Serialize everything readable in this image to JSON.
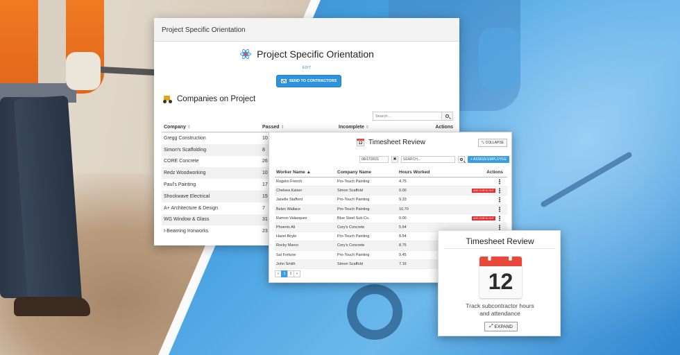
{
  "orientation": {
    "window_title": "Project Specific Orientation",
    "heading": "Project Specific Orientation",
    "edit_label": "EDIT",
    "send_label": "SEND TO CONTRACTORS",
    "companies_heading": "Companies on Project",
    "search_placeholder": "Search...",
    "columns": [
      "Company",
      "Passed",
      "Incomplete",
      "Actions"
    ],
    "rows": [
      {
        "company": "Gregg Construction",
        "passed": "10"
      },
      {
        "company": "Simon's Scaffolding",
        "passed": "8"
      },
      {
        "company": "CORE Concrete",
        "passed": "26"
      },
      {
        "company": "Redz Woodworking",
        "passed": "10"
      },
      {
        "company": "Paul's Painting",
        "passed": "17"
      },
      {
        "company": "Shockwave Electrical",
        "passed": "15"
      },
      {
        "company": "A+ Architecture & Design",
        "passed": "7"
      },
      {
        "company": "WG Window & Glass",
        "passed": "31"
      },
      {
        "company": "I-Beaming Ironworks",
        "passed": "23"
      }
    ]
  },
  "timesheet": {
    "title": "Timesheet Review",
    "calendar_day": "12",
    "collapse_label": "COLLAPSE",
    "date_value": "06/17/2021",
    "clear_label": "✖",
    "search_placeholder": "SEARCH...",
    "assign_label": "+ ASSIGN EMPLOYEE",
    "columns": [
      "Worker Name ▲",
      "Company Name",
      "Hours Worked",
      "Actions"
    ],
    "checkout_label": "ADD CHECK-OUT",
    "rows": [
      {
        "worker": "Rogelio French",
        "company": "Pro-Touch Painting",
        "hours": "4.75",
        "checkout": false
      },
      {
        "worker": "Chelsea Kaiser",
        "company": "Simon Scaffold",
        "hours": "0.00",
        "checkout": true
      },
      {
        "worker": "Janelle Stafford",
        "company": "Pro-Touch Painting",
        "hours": "9.33",
        "checkout": false
      },
      {
        "worker": "Belen Wallace",
        "company": "Pro-Touch Painting",
        "hours": "10.70",
        "checkout": false
      },
      {
        "worker": "Ramon Valasquez",
        "company": "Blue Steel Sub Co.",
        "hours": "0.00",
        "checkout": true
      },
      {
        "worker": "Phoenix Ali",
        "company": "Cory's Concrete",
        "hours": "5.64",
        "checkout": false
      },
      {
        "worker": "Hazel Boyle",
        "company": "Pro-Touch Painting",
        "hours": "8.54",
        "checkout": false
      },
      {
        "worker": "Rocky Marco",
        "company": "Cory's Concrete",
        "hours": "8.75",
        "checkout": false
      },
      {
        "worker": "Sal Fortune",
        "company": "Pro-Touch Painting",
        "hours": "9.45",
        "checkout": false
      },
      {
        "worker": "John Smith",
        "company": "Simon Scaffold",
        "hours": "7.16",
        "checkout": false
      }
    ],
    "pager": {
      "prev": "«",
      "pages": [
        "1",
        "2"
      ],
      "active": "1",
      "next": "»"
    }
  },
  "widget": {
    "title": "Timesheet Review",
    "calendar_day": "12",
    "description_line1": "Track subcontractor hours",
    "description_line2": "and attendance",
    "expand_label": "EXPAND"
  },
  "colors": {
    "brand_blue": "#2f93dc",
    "calendar_red": "#e8493b",
    "checkout_red": "#e02d2d"
  }
}
